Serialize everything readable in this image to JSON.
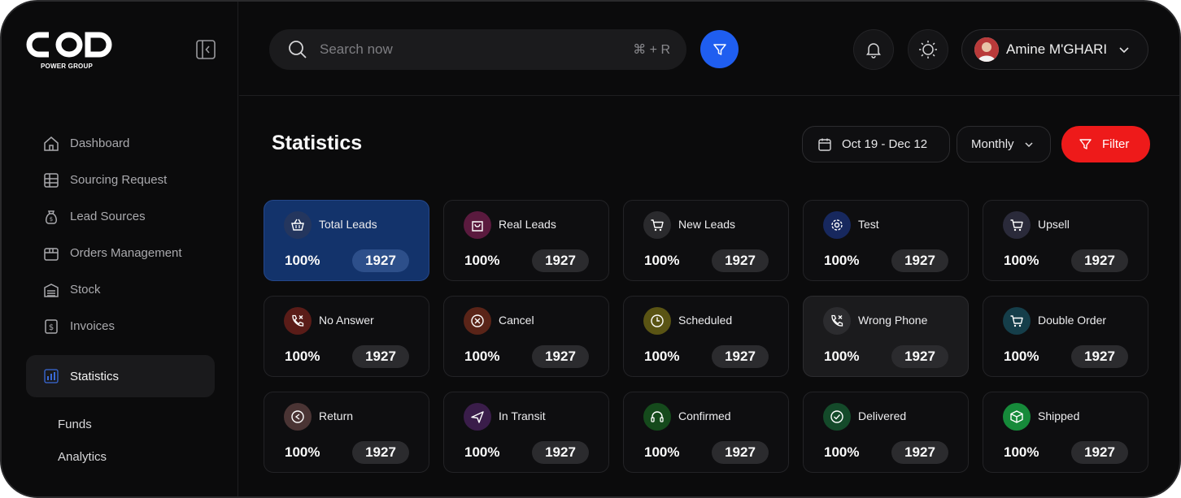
{
  "brand": {
    "logo_text": "COD",
    "logo_sub": "POWER GROUP"
  },
  "sidebar": {
    "items": [
      {
        "label": "Dashboard",
        "icon": "home-icon"
      },
      {
        "label": "Sourcing Request",
        "icon": "table-icon"
      },
      {
        "label": "Lead Sources",
        "icon": "bag-dollar-icon"
      },
      {
        "label": "Orders Management",
        "icon": "box-icon"
      },
      {
        "label": "Stock",
        "icon": "warehouse-icon"
      },
      {
        "label": "Invoices",
        "icon": "dollar-doc-icon"
      },
      {
        "label": "Statistics",
        "icon": "bar-chart-icon",
        "active": true
      }
    ],
    "sub_items": [
      {
        "label": "Funds"
      },
      {
        "label": "Analytics"
      }
    ]
  },
  "search": {
    "placeholder": "Search now",
    "shortcut": "⌘ + R"
  },
  "user": {
    "name": "Amine M'GHARI"
  },
  "page": {
    "title": "Statistics",
    "date_range": "Oct 19 - Dec 12",
    "period": "Monthly",
    "filter_label": "Filter"
  },
  "colors": {
    "accent_blue": "#1f5ef0",
    "filter_red": "#ee1a1a",
    "highlight_card": "#13336b"
  },
  "cards": [
    {
      "label": "Total Leads",
      "percent": "100%",
      "count": "1927",
      "icon": "basket-icon",
      "icon_bg": "#24365e"
    },
    {
      "label": "Real Leads",
      "percent": "100%",
      "count": "1927",
      "icon": "bag-icon",
      "icon_bg": "#5a1a3e"
    },
    {
      "label": "New Leads",
      "percent": "100%",
      "count": "1927",
      "icon": "cart-icon",
      "icon_bg": "#2a2a2d"
    },
    {
      "label": "Test",
      "percent": "100%",
      "count": "1927",
      "icon": "gear-icon",
      "icon_bg": "#17285e"
    },
    {
      "label": "Upsell",
      "percent": "100%",
      "count": "1927",
      "icon": "cart-icon",
      "icon_bg": "#2a2a3a"
    },
    {
      "label": "No Answer",
      "percent": "100%",
      "count": "1927",
      "icon": "phone-x-icon",
      "icon_bg": "#5a1c18"
    },
    {
      "label": "Cancel",
      "percent": "100%",
      "count": "1927",
      "icon": "x-circle-icon",
      "icon_bg": "#5a2418"
    },
    {
      "label": "Scheduled",
      "percent": "100%",
      "count": "1927",
      "icon": "clock-icon",
      "icon_bg": "#5a5414"
    },
    {
      "label": "Wrong Phone",
      "percent": "100%",
      "count": "1927",
      "icon": "phone-x-icon",
      "icon_bg": "#2c2c2f"
    },
    {
      "label": "Double Order",
      "percent": "100%",
      "count": "1927",
      "icon": "cart-icon",
      "icon_bg": "#153e4a"
    },
    {
      "label": "Return",
      "percent": "100%",
      "count": "1927",
      "icon": "return-icon",
      "icon_bg": "#4a3434"
    },
    {
      "label": "In Transit",
      "percent": "100%",
      "count": "1927",
      "icon": "plane-icon",
      "icon_bg": "#3a1d4a"
    },
    {
      "label": "Confirmed",
      "percent": "100%",
      "count": "1927",
      "icon": "headset-icon",
      "icon_bg": "#154a1c"
    },
    {
      "label": "Delivered",
      "percent": "100%",
      "count": "1927",
      "icon": "check-circle-icon",
      "icon_bg": "#144a2a"
    },
    {
      "label": "Shipped",
      "percent": "100%",
      "count": "1927",
      "icon": "package-icon",
      "icon_bg": "#168a3a"
    }
  ]
}
